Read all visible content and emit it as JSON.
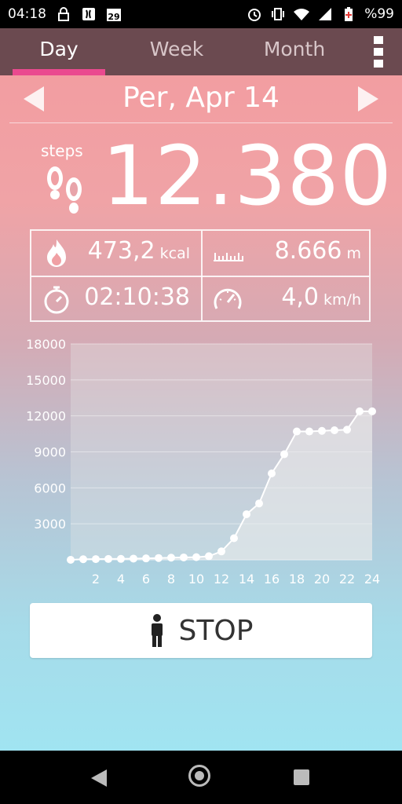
{
  "status_bar": {
    "time": "04:18",
    "battery": "%99",
    "left_icons": [
      "lock-icon",
      "app-notification-icon",
      "calendar-icon"
    ],
    "right_icons": [
      "alarm-icon",
      "vibrate-icon",
      "wifi-icon",
      "signal-icon",
      "battery-icon"
    ]
  },
  "tabs": [
    {
      "label": "Day",
      "active": true
    },
    {
      "label": "Week",
      "active": false
    },
    {
      "label": "Month",
      "active": false
    }
  ],
  "date": {
    "label": "Per, Apr 14",
    "prev_icon": "arrow-left-icon",
    "next_icon": "arrow-right-icon"
  },
  "steps": {
    "label": "steps",
    "value": "12.380",
    "icon": "footprints-icon"
  },
  "stats": {
    "calories": {
      "value": "473,2",
      "unit": "kcal",
      "icon": "flame-icon"
    },
    "distance": {
      "value": "8.666",
      "unit": "m",
      "icon": "ruler-icon"
    },
    "duration": {
      "value": "02:10:38",
      "unit": "",
      "icon": "stopwatch-icon"
    },
    "speed": {
      "value": "4,0",
      "unit": "km/h",
      "icon": "speedometer-icon"
    }
  },
  "chart_data": {
    "type": "line",
    "title": "",
    "xlabel": "",
    "ylabel": "",
    "ylim": [
      0,
      18000
    ],
    "xlim": [
      0,
      24
    ],
    "yticks": [
      3000,
      6000,
      9000,
      12000,
      15000,
      18000
    ],
    "xticks": [
      2,
      4,
      6,
      8,
      10,
      12,
      14,
      16,
      18,
      20,
      22,
      24
    ],
    "grid": true,
    "series": [
      {
        "x": [
          0,
          1,
          2,
          3,
          4,
          5,
          6,
          7,
          8,
          9,
          10,
          11,
          12,
          13,
          14,
          15,
          16,
          17,
          18,
          19,
          20,
          21,
          22,
          23,
          24
        ],
        "values": [
          0,
          50,
          60,
          70,
          80,
          100,
          120,
          150,
          180,
          200,
          220,
          300,
          700,
          1800,
          3800,
          4700,
          7200,
          8800,
          10700,
          10700,
          10750,
          10800,
          10850,
          12380,
          12380
        ]
      }
    ],
    "colors": {
      "line": "#ffffff",
      "fill": "#e6e6e6"
    }
  },
  "stop_button": {
    "label": "STOP",
    "icon": "person-icon"
  },
  "nav_bar": {
    "back_icon": "back-icon",
    "home_icon": "home-icon",
    "recents_icon": "recents-icon"
  }
}
